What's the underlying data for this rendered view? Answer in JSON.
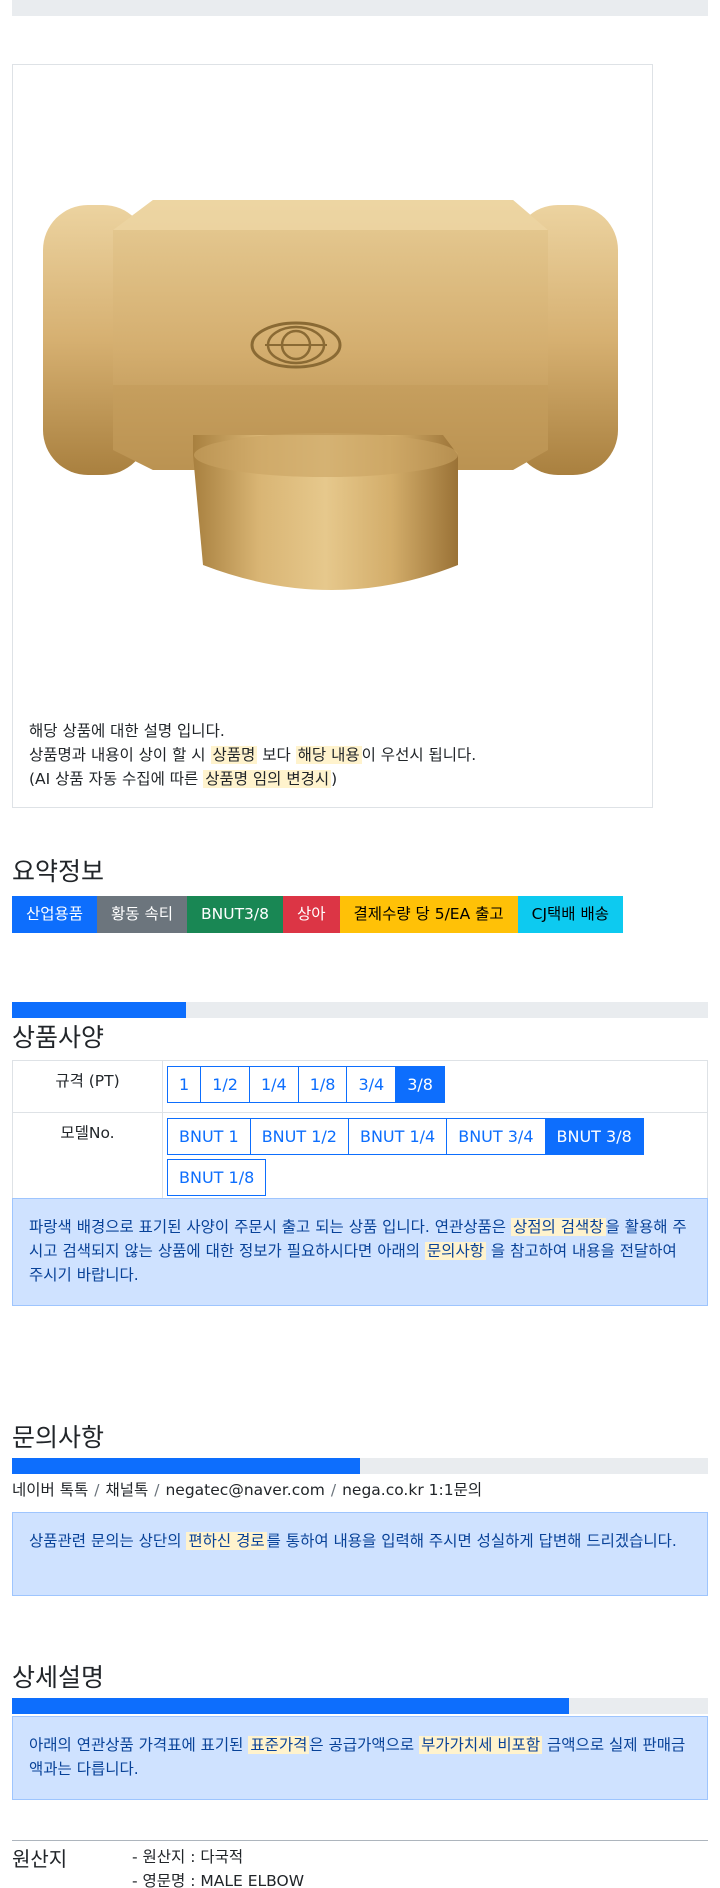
{
  "product": {
    "image_alt": "brass tee fitting",
    "desc_line1": "해당 상품에 대한 설명 입니다.",
    "desc_line2_a": "상품명과 내용이 상이 할 시 ",
    "desc_line2_hl1": "상품명",
    "desc_line2_b": " 보다 ",
    "desc_line2_hl2": "해당 내용",
    "desc_line2_c": "이 우선시 됩니다.",
    "desc_line3_a": "(AI 상품 자동 수집에 따른 ",
    "desc_line3_hl": "상품명 임의 변경시",
    "desc_line3_b": ")"
  },
  "summary": {
    "title": "요약정보",
    "badges": [
      "산업용품",
      "황동 속티",
      "BNUT3/8",
      "상아",
      "결제수량 당 5/EA 출고",
      "CJ택배 배송"
    ]
  },
  "spec": {
    "title": "상품사양",
    "progress": 0.25,
    "rows": [
      {
        "label": "규격 (PT)",
        "options": [
          "1",
          "1/2",
          "1/4",
          "1/8",
          "3/4",
          "3/8"
        ],
        "active": 5
      },
      {
        "label": "모델No.",
        "options": [
          "BNUT 1",
          "BNUT 1/2",
          "BNUT 1/4",
          "BNUT 3/4",
          "BNUT 3/8",
          "BNUT 1/8"
        ],
        "active": 4
      }
    ],
    "notice_a": "파랑색 배경으로 표기된 사양이 주문시 출고 되는 상품 입니다. 연관상품은 ",
    "notice_hl1": "상점의 검색창",
    "notice_b": "을 활용해 주시고 검색되지 않는 상품에 대한 정보가 필요하시다면 아래의 ",
    "notice_hl2": "문의사항",
    "notice_c": " 을 참고하여 내용을 전달하여 주시기 바랍니다."
  },
  "inquiry": {
    "title": "문의사항",
    "progress": 0.5,
    "links": [
      "네이버 톡톡",
      "채널톡",
      "negatec@naver.com",
      "nega.co.kr 1:1문의"
    ],
    "notice_a": "상품관련 문의는 상단의 ",
    "notice_hl": "편하신 경로",
    "notice_b": "를 통하여 내용을 입력해 주시면 성실하게 답변해 드리겠습니다."
  },
  "detail": {
    "title": "상세설명",
    "progress": 0.8,
    "notice_a": "아래의 연관상품 가격표에 표기된 ",
    "notice_hl1": "표준가격",
    "notice_b": "은 공급가액으로 ",
    "notice_hl2": "부가가치세 비포함",
    "notice_c": " 금액으로 실제 판매금액과는 다릅니다."
  },
  "origin": {
    "title": "원산지",
    "items": [
      "- 원산지 : 다국적",
      "- 영문명 : MALE ELBOW"
    ]
  }
}
